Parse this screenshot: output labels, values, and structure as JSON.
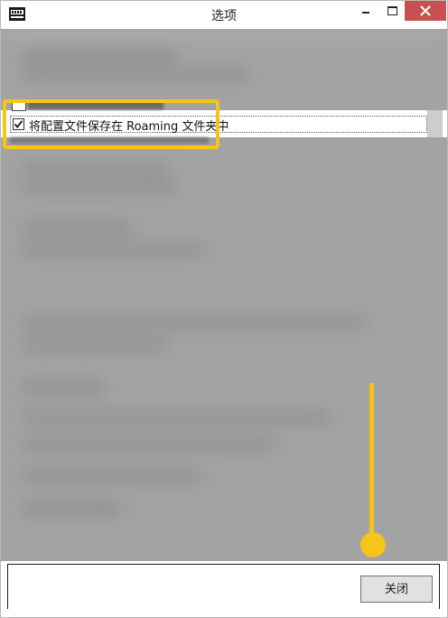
{
  "window": {
    "title": "选项"
  },
  "list": {
    "checkbox_label": "将配置文件保存在 Roaming 文件夹中",
    "checked": true
  },
  "footer": {
    "close_button_label": "关闭"
  },
  "annotation": {
    "highlight_color": "#f5c518"
  },
  "icons": {
    "app": "app-icon",
    "minimize": "minimize-icon",
    "maximize": "maximize-icon",
    "close": "close-icon",
    "check": "checkmark-icon"
  },
  "colors": {
    "close_button_bg": "#c75050",
    "blurred_overlay": "#a3a3a3",
    "highlight": "#f5c518"
  }
}
